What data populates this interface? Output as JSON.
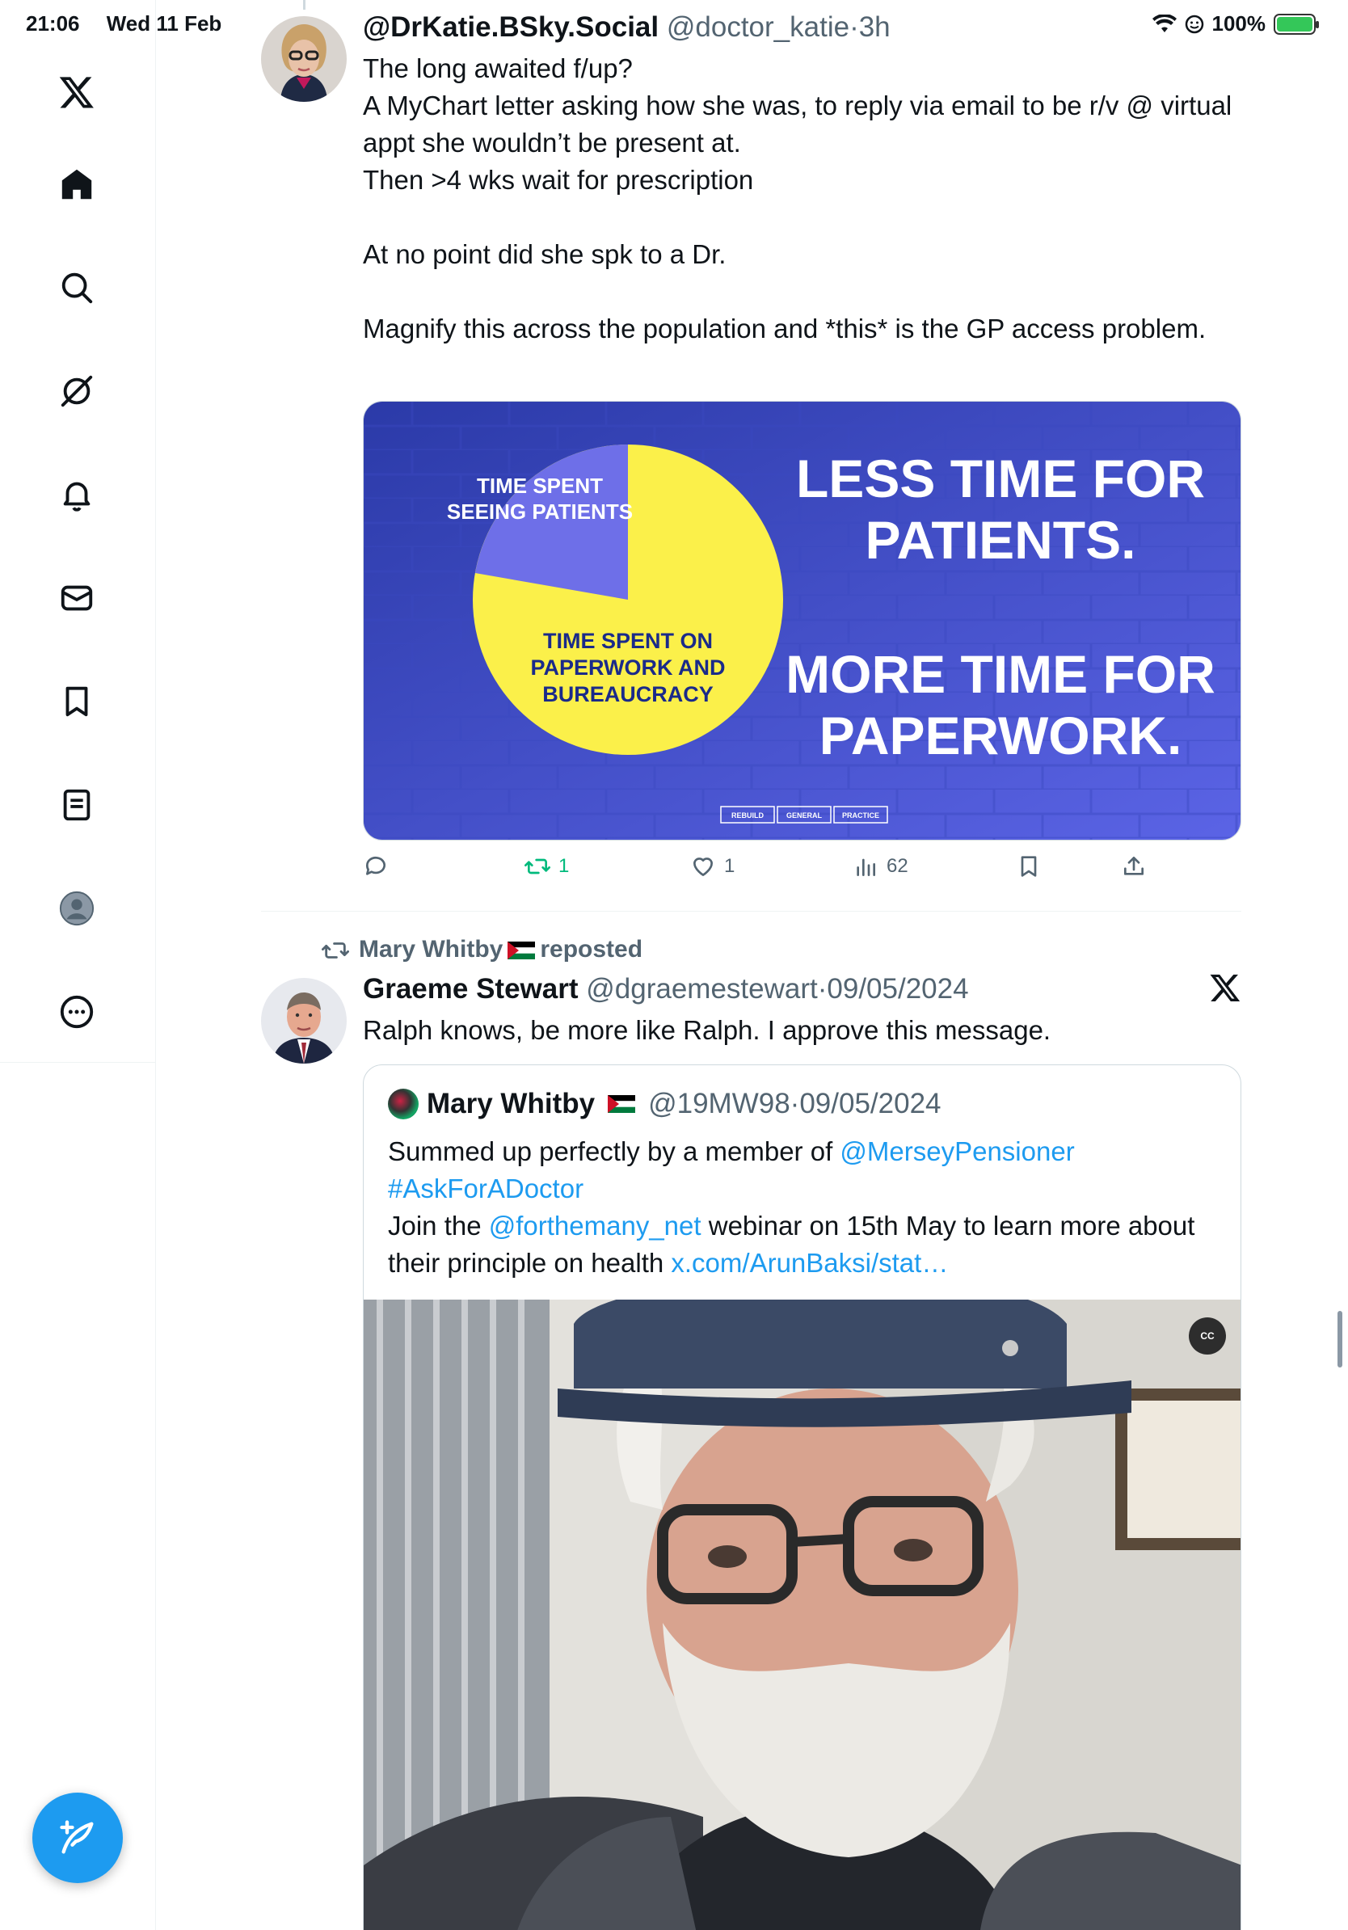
{
  "status_bar": {
    "time": "21:06",
    "date": "Wed 11 Feb",
    "battery": "100%"
  },
  "sidebar": {
    "items": [
      {
        "icon": "x-logo-icon"
      },
      {
        "icon": "home-icon"
      },
      {
        "icon": "search-icon"
      },
      {
        "icon": "grok-icon"
      },
      {
        "icon": "bell-icon"
      },
      {
        "icon": "mail-icon"
      },
      {
        "icon": "bookmark-icon"
      },
      {
        "icon": "lists-icon"
      },
      {
        "icon": "profile-icon"
      },
      {
        "icon": "more-icon"
      }
    ],
    "compose_icon": "compose-icon"
  },
  "tweet1": {
    "name": "@DrKatie.BSky.Social",
    "handle": "@doctor_katie",
    "time": "3h",
    "text": "The long awaited f/up?\nA MyChart letter asking how she was, to reply via email to be r/v @ virtual appt she wouldn’t be present at.\nThen >4 wks wait for prescription\n\nAt no point did she spk to a Dr.\n\nMagnify this across the population and *this* is the GP access problem.",
    "media": {
      "pie_label_small": "TIME SPENT\nSEEING PATIENTS",
      "pie_label_large": "TIME SPENT ON\nPAPERWORK AND\nBUREAUCRACY",
      "headline1": "LESS TIME FOR\nPATIENTS.",
      "headline2": "MORE TIME FOR\nPAPERWORK.",
      "footer": [
        "REBUILD",
        "GENERAL",
        "PRACTICE"
      ]
    },
    "actions": {
      "replies": "",
      "reposts": "1",
      "likes": "1",
      "views": "62"
    },
    "colors": {
      "repost_active": "#00ba7c"
    }
  },
  "tweet2": {
    "repost_by": "Mary Whitby",
    "repost_suffix": "reposted",
    "name": "Graeme Stewart",
    "handle": "@dgraemestewart",
    "time": "09/05/2024",
    "text": "Ralph knows, be more like Ralph. I approve this message.",
    "quote": {
      "name": "Mary Whitby",
      "handle": "@19MW98",
      "time": "09/05/2024",
      "text_1": "Summed up perfectly by a member of ",
      "mention_1": "@MerseyPensioner",
      "hashtag": "#AskForADoctor",
      "text_2": "Join the ",
      "mention_2": "@forthemany_net",
      "text_3": " webinar on 15th May to learn more about their principle on health ",
      "link": "x.com/ArunBaksi/stat…",
      "video_cc": "CC"
    }
  }
}
